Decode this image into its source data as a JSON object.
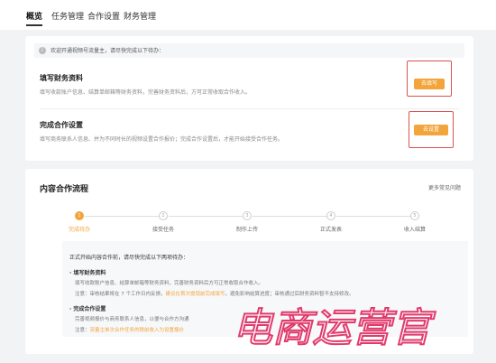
{
  "nav": {
    "tabs": [
      {
        "label": "概览",
        "active": true
      },
      {
        "label": "任务管理",
        "active": false
      },
      {
        "label": "合作设置",
        "active": false
      },
      {
        "label": "财务管理",
        "active": false
      }
    ]
  },
  "notice": {
    "text": "欢迎开通视频号流量主，请尽快完成以下待办："
  },
  "todos": [
    {
      "title": "填写财务资料",
      "desc": "填写收款账户信息、结算单邮箱等财务资料，完善财务资料后，方可正常收取合作收入。",
      "button": "去填写"
    },
    {
      "title": "完成合作设置",
      "desc": "填写商务联系人信息、并为不同时长的视频设置合作报价；完成合作设置后，才能开始接受合作任务。",
      "button": "去设置"
    }
  ],
  "flow": {
    "title": "内容合作流程",
    "faq_link": "更多常见问题",
    "steps": [
      {
        "num": "1",
        "label": "完成待办",
        "active": true
      },
      {
        "num": "2",
        "label": "接受任务",
        "active": false
      },
      {
        "num": "3",
        "label": "制作上传",
        "active": false
      },
      {
        "num": "4",
        "label": "正式发表",
        "active": false
      },
      {
        "num": "5",
        "label": "收入结算",
        "active": false
      }
    ],
    "detail": {
      "intro": "正式开始内容合作前，请尽快完成以下两项待办：",
      "item1_title": "· 填写财务资料",
      "item1_desc": "填写收款账户信息、结算单邮箱等财务资料，完善财务资料后方可正常收取合作收入。",
      "item1_note_prefix": "注意：审核结果将在 7 个工作日内反馈，",
      "item1_note_highlight": "建议在首次提现前完成填写",
      "item1_note_suffix": "，避免影响结算进度；审核通过后财务资料暂不支持修改。",
      "item2_title": "· 完成合作设置",
      "item2_desc": "完善视频报价与商务联系人信息，以便与合作方沟通",
      "item2_note_prefix": "注意：",
      "item2_note_highlight": "流量主单次合作任务的税前收入为设置报价"
    }
  },
  "watermark": {
    "text": "电商运营官"
  },
  "colors": {
    "accent": "#f3a43a",
    "highlight_box": "#d9534f"
  }
}
